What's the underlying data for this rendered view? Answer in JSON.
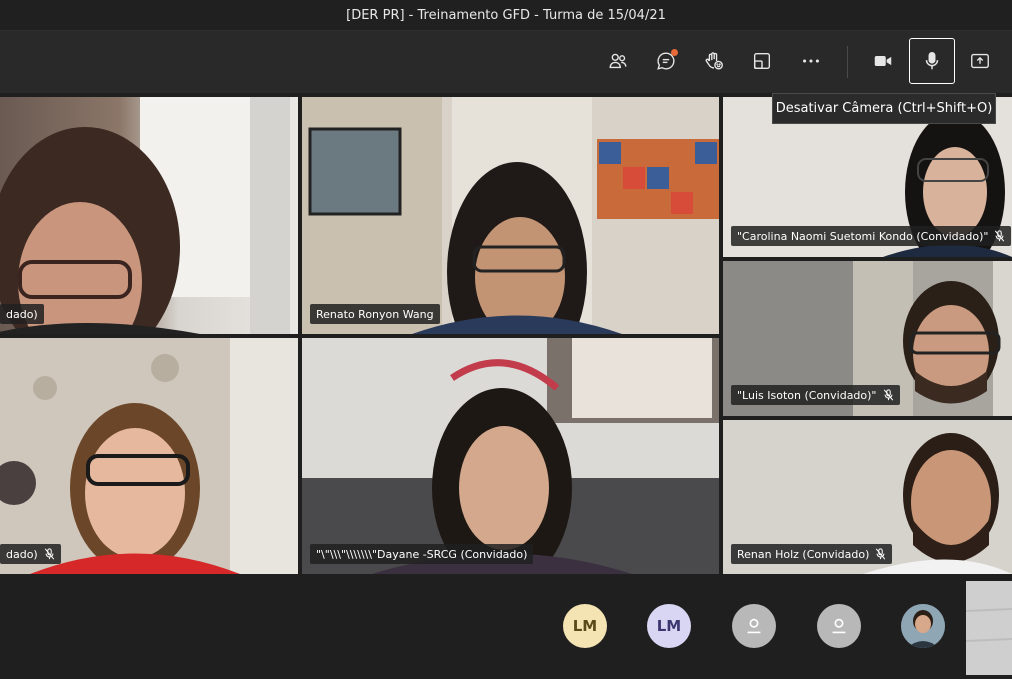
{
  "window": {
    "title": "[DER PR] - Treinamento GFD - Turma de 15/04/21"
  },
  "toolbar": {
    "buttons": [
      {
        "name": "people-icon"
      },
      {
        "name": "chat-icon"
      },
      {
        "name": "raise-hand-icon"
      },
      {
        "name": "rooms-icon"
      },
      {
        "name": "more-icon"
      },
      {
        "name": "camera-icon"
      },
      {
        "name": "microphone-icon"
      },
      {
        "name": "share-icon"
      }
    ]
  },
  "tooltip": {
    "text": "Desativar Câmera (Ctrl+Shift+O)"
  },
  "participants": [
    {
      "label": "dado)",
      "muted": false
    },
    {
      "label": "Renato Ronyon Wang",
      "muted": false
    },
    {
      "label": "\"Carolina Naomi Suetomi Kondo (Convidado)\"",
      "muted": true
    },
    {
      "label": "\"Luis Isoton (Convidado)\"",
      "muted": true
    },
    {
      "label": "dado)",
      "muted": true
    },
    {
      "label": "\"\\\"\\\\\\\"\\\\\\\\\\\\\\\"Dayane -SRCG (Convidado)",
      "muted": false
    },
    {
      "label": "Renan Holz (Convidado)",
      "muted": true
    }
  ],
  "bottom_avatars": [
    {
      "initials": "LM",
      "bg": "#f4e3b3",
      "fg": "#5a4a1a"
    },
    {
      "initials": "LM",
      "bg": "#d9d6f3",
      "fg": "#3b3770"
    },
    {
      "initials": "",
      "bg": "#b8b8b8",
      "fg": "#4a4a4a"
    },
    {
      "initials": "",
      "bg": "#b8b8b8",
      "fg": "#4a4a4a"
    },
    {
      "initials": "",
      "bg": "#3f5a6e",
      "fg": "#ffffff"
    }
  ]
}
